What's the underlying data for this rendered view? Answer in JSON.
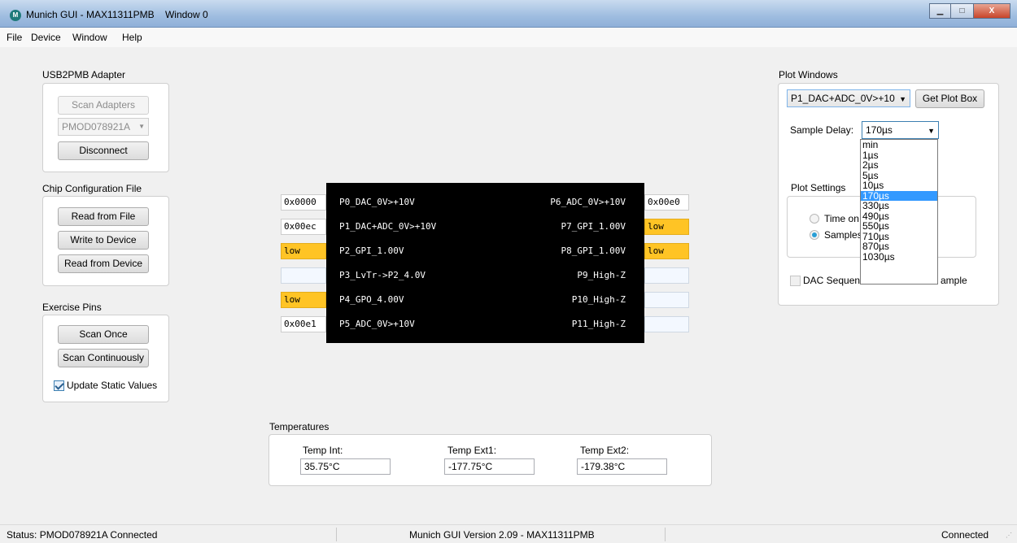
{
  "window": {
    "title": "Munich GUI - MAX11311PMB",
    "subtitle": "Window 0",
    "minimize": "▁",
    "maximize": "□",
    "close": "X"
  },
  "menu": [
    "File",
    "Device",
    "Window",
    "Help"
  ],
  "usb_adapter": {
    "title": "USB2PMB Adapter",
    "scan_button": "Scan Adapters",
    "adapter_value": "PMOD078921A",
    "disconnect_button": "Disconnect"
  },
  "chip_config": {
    "title": "Chip Configuration File",
    "read_file": "Read from File",
    "write_device": "Write to Device",
    "read_device": "Read from Device"
  },
  "exercise_pins": {
    "title": "Exercise Pins",
    "scan_once": "Scan Once",
    "scan_continuous": "Scan Continuously",
    "update_static": "Update Static Values",
    "update_static_checked": true
  },
  "pins": {
    "left_values": [
      "0x0000",
      "0x00ec",
      "low",
      "",
      "low",
      "0x00e1"
    ],
    "left_states": [
      "plain",
      "plain",
      "low",
      "empty",
      "low",
      "plain"
    ],
    "left_labels": [
      "P0_DAC_0V>+10V",
      "P1_DAC+ADC_0V>+10V",
      "P2_GPI_1.00V",
      "P3_LvTr->P2_4.0V",
      "P4_GPO_4.00V",
      "P5_ADC_0V>+10V"
    ],
    "right_labels": [
      "P6_ADC_0V>+10V",
      "P7_GPI_1.00V",
      "P8_GPI_1.00V",
      "P9_High-Z",
      "P10_High-Z",
      "P11_High-Z"
    ],
    "right_values": [
      "0x00e0",
      "low",
      "low",
      "",
      "",
      ""
    ],
    "right_states": [
      "plain",
      "low",
      "low",
      "empty",
      "empty",
      "empty"
    ]
  },
  "temperatures": {
    "title": "Temperatures",
    "int_label": "Temp Int:",
    "int_value": "35.75°C",
    "ext1_label": "Temp Ext1:",
    "ext1_value": "-177.75°C",
    "ext2_label": "Temp Ext2:",
    "ext2_value": "-179.38°C"
  },
  "plot_windows": {
    "title": "Plot Windows",
    "plot_select": "P1_DAC+ADC_0V>+10",
    "get_plot_box": "Get Plot Box",
    "sample_delay_label": "Sample Delay:",
    "sample_delay_value": "170µs",
    "delay_options": [
      "min",
      "1µs",
      "2µs",
      "5µs",
      "10µs",
      "170µs",
      "330µs",
      "490µs",
      "550µs",
      "710µs",
      "870µs",
      "1030µs"
    ],
    "delay_selected": "170µs",
    "plot_settings_title": "Plot Settings",
    "radio_time": "Time on",
    "radio_samples": "Samples",
    "dac_seq_left": "DAC Sequen",
    "dac_seq_right": "ample"
  },
  "status": {
    "left": "Status: PMOD078921A Connected",
    "center": "Munich GUI Version 2.09 - MAX11311PMB",
    "right": "Connected"
  }
}
